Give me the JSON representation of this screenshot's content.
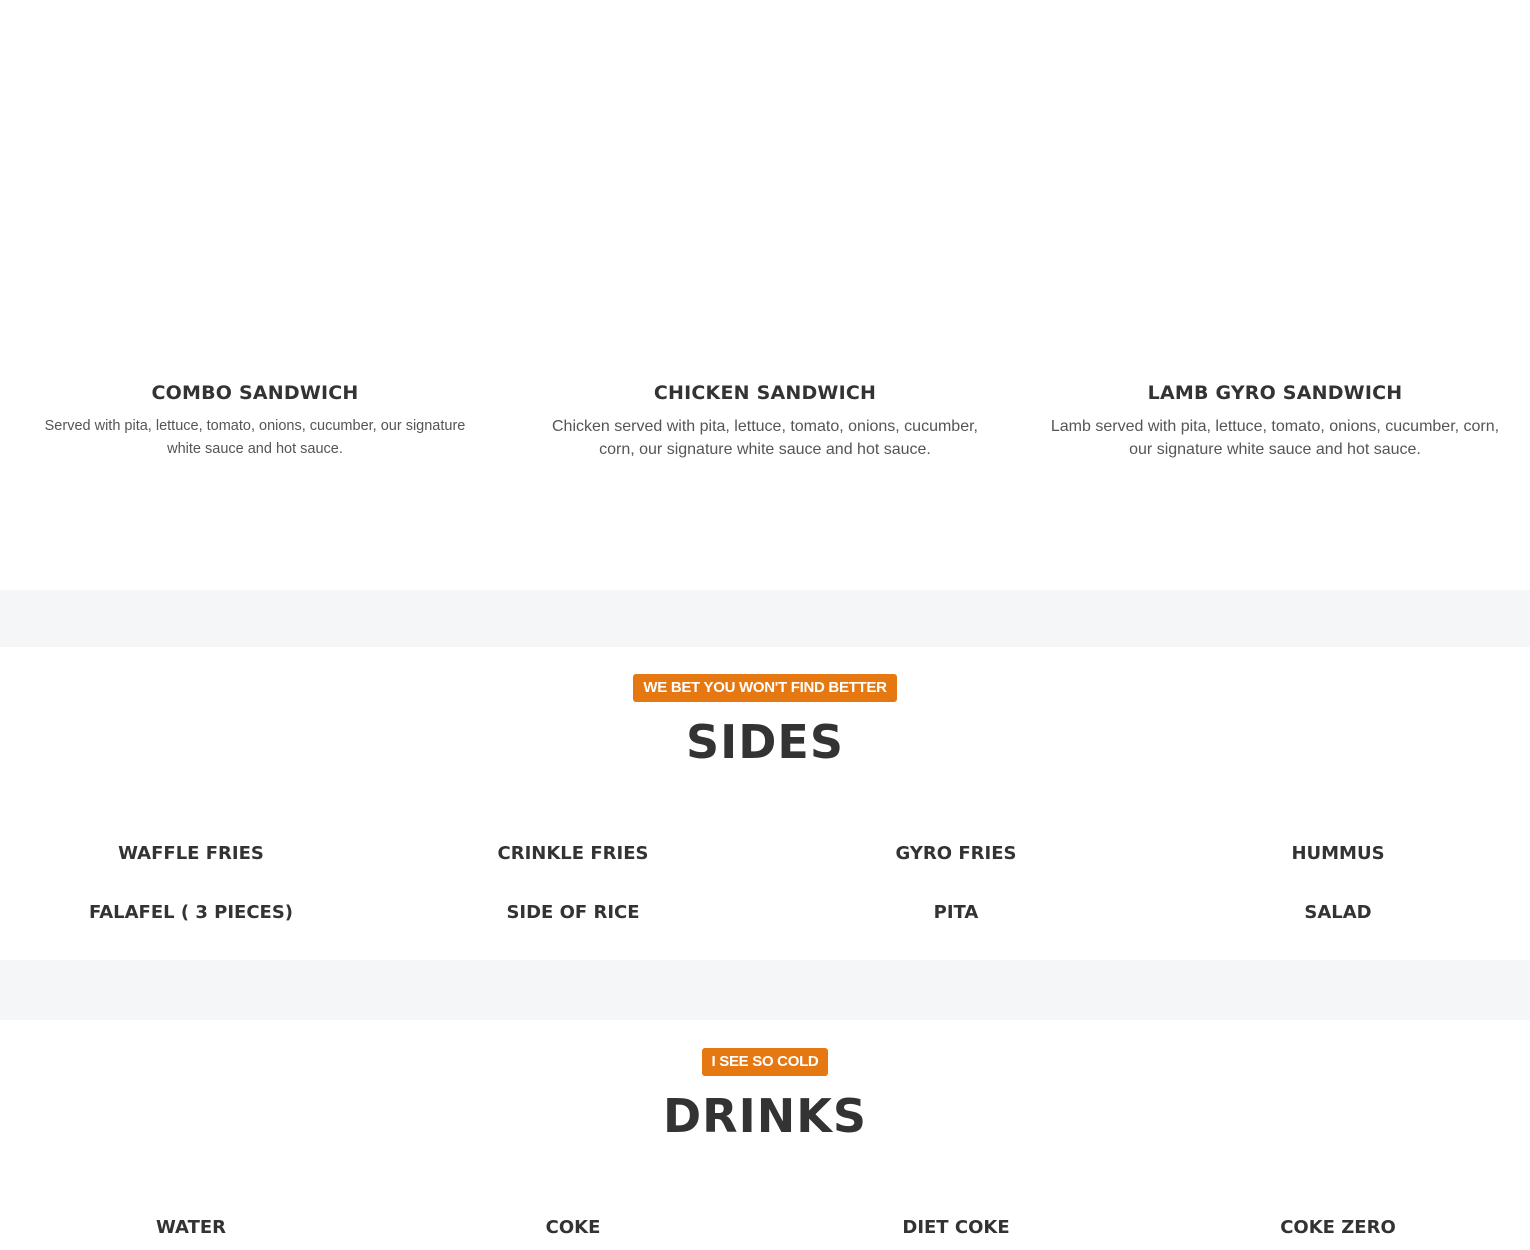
{
  "sandwiches": [
    {
      "title": "COMBO SANDWICH",
      "description": "Served with pita, lettuce, tomato, onions, cucumber, our signature white sauce and hot sauce."
    },
    {
      "title": "CHICKEN SANDWICH",
      "description": "Chicken served with pita, lettuce, tomato, onions, cucumber, corn, our signature white sauce and hot sauce."
    },
    {
      "title": "LAMB GYRO SANDWICH",
      "description": "Lamb served with pita, lettuce, tomato, onions, cucumber, corn, our signature white sauce and hot sauce."
    }
  ],
  "sides": {
    "badge": "WE BET YOU WON'T FIND BETTER",
    "title": "SIDES",
    "items": [
      "WAFFLE FRIES",
      "CRINKLE FRIES",
      "GYRO FRIES",
      "HUMMUS",
      "FALAFEL ( 3 PIECES)",
      "SIDE OF RICE",
      "PITA",
      "SALAD"
    ]
  },
  "drinks": {
    "badge": "I SEE SO COLD",
    "title": "DRINKS",
    "items": [
      "WATER",
      "COKE",
      "DIET COKE",
      "COKE ZERO"
    ]
  },
  "colors": {
    "accent": "#e67812",
    "heading": "#333333",
    "body_text": "#555555",
    "separator_bg": "#f5f6f8"
  }
}
